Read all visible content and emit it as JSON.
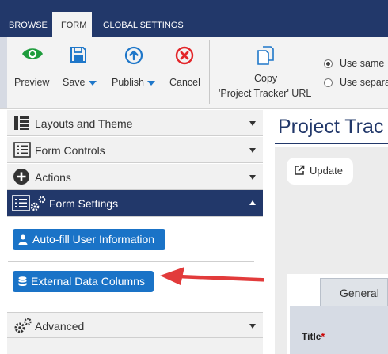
{
  "tabs": [
    {
      "label": "BROWSE"
    },
    {
      "label": "FORM"
    },
    {
      "label": "GLOBAL SETTINGS"
    }
  ],
  "ribbon": {
    "preview_label": "Preview",
    "save_label": "Save",
    "publish_label": "Publish",
    "cancel_label": "Cancel",
    "copy_line1": "Copy",
    "copy_line2": "'Project Tracker' URL",
    "radio_options": [
      {
        "label": "Use same",
        "selected": true
      },
      {
        "label": "Use separa",
        "selected": false
      }
    ]
  },
  "panel": {
    "sections": [
      {
        "label": "Layouts and Theme",
        "icon": "layout-icon"
      },
      {
        "label": "Form Controls",
        "icon": "form-controls-icon"
      },
      {
        "label": "Actions",
        "icon": "plus-circle-icon"
      },
      {
        "label": "Form Settings",
        "icon": "form-settings-icon",
        "expanded": true
      },
      {
        "label": "Advanced",
        "icon": "gears-icon"
      }
    ],
    "autofill_label": "Auto-fill User Information",
    "external_data_label": "External Data Columns"
  },
  "preview": {
    "title": "Project Trac",
    "update_label": "Update",
    "tab_label": "General",
    "field_label": "Title",
    "required_mark": "*"
  },
  "colors": {
    "navy": "#22386a",
    "blue_button": "#1a73c7",
    "arrow_red": "#e23b3b",
    "preview_green": "#1e9c3c",
    "cancel_red": "#e3262a",
    "icon_blue": "#1f77c9"
  }
}
